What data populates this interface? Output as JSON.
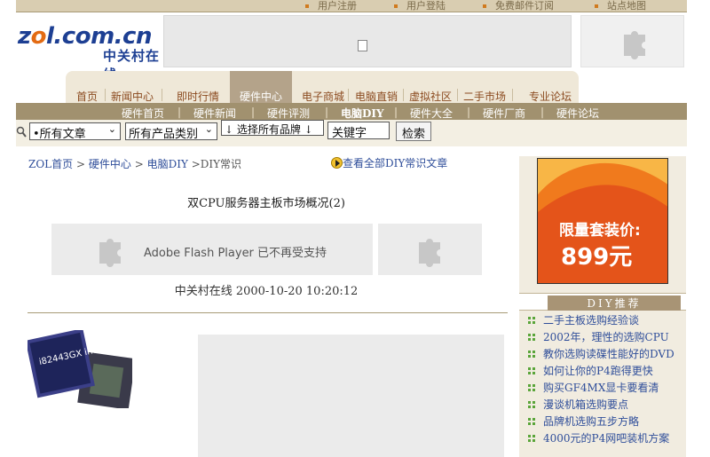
{
  "top_links": [
    "用户注册",
    "用户登陆",
    "免费邮件订阅",
    "站点地图"
  ],
  "logo": {
    "text_main": "zol.com.cn",
    "text_cn": "中关村在线"
  },
  "tabs": [
    "首页",
    "新闻中心",
    "即时行情",
    "硬件中心",
    "电子商城",
    "电脑直销",
    "虚拟社区",
    "二手市场",
    "专业论坛"
  ],
  "active_tab": "硬件中心",
  "subnav": [
    "硬件首页",
    "硬件新闻",
    "硬件评测",
    "电脑DIY",
    "硬件大全",
    "硬件厂商",
    "硬件论坛"
  ],
  "search": {
    "article_select": "•所有文章",
    "category_select": "所有产品类别",
    "brand_select": "↓ 选择所有品牌 ↓",
    "keyword_value": "关键字",
    "submit_label": "检索"
  },
  "breadcrumb": {
    "home": "ZOL首页",
    "hardware": "硬件中心",
    "diy": "电脑DIY",
    "current": "DIY常识",
    "sep": ">"
  },
  "view_all": "查看全部DIY常识文章",
  "article": {
    "title": "双CPU服务器主板市场概况(2)",
    "flash_msg": "Adobe Flash Player 已不再受支持",
    "source_date": "中关村在线  2000-10-20  10:20:12",
    "chip_label": "i82443GX intel"
  },
  "ad": {
    "line1": "限量套装价:",
    "line2": "899元"
  },
  "recommend": {
    "title": "DIY推荐",
    "items": [
      "二手主板选购经验谈",
      "2002年，理性的选购CPU",
      "教你选购读碟性能好的DVD",
      "如何让你的P4跑得更快",
      "购买GF4MX显卡要看清",
      "漫谈机箱选购要点",
      "品牌机选购五步方略",
      "4000元的P4网吧装机方案"
    ]
  }
}
